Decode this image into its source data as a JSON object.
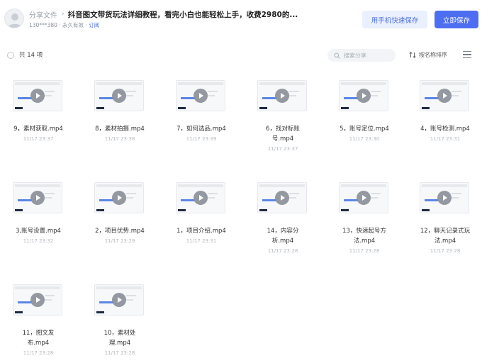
{
  "header": {
    "crumb_link": "分享文件",
    "crumb_sep": "›",
    "title": "抖音图文带货玩法详细教程，看完小白也能轻松上手，收费2980的...",
    "user_meta": "130***380 · 永久有效 · ",
    "subscribe": "订阅",
    "mobile_save": "用手机快速保存",
    "save_now": "立即保存"
  },
  "toolbar": {
    "count": "共 14 项",
    "search_placeholder": "搜索分享",
    "sort_label": "按名称排序"
  },
  "files": [
    {
      "line1": "9，素材获取.mp4",
      "line2": "",
      "date": "11/17 23:37"
    },
    {
      "line1": "8，素材拍摄.mp4",
      "line2": "",
      "date": "11/17 23:38"
    },
    {
      "line1": "7，如何选品.mp4",
      "line2": "",
      "date": "11/17 23:39"
    },
    {
      "line1": "6，找对标账",
      "line2": "号.mp4",
      "date": "11/17 23:37"
    },
    {
      "line1": "5，账号定位.mp4",
      "line2": "",
      "date": "11/17 23:30"
    },
    {
      "line1": "4，账号检测.mp4",
      "line2": "",
      "date": "11/17 23:31"
    },
    {
      "line1": "3,账号设置.mp4",
      "line2": "",
      "date": "11/17 23:32"
    },
    {
      "line1": "2，项目优势.mp4",
      "line2": "",
      "date": "11/17 23:29"
    },
    {
      "line1": "1，项目介绍.mp4",
      "line2": "",
      "date": "11/17 23:31"
    },
    {
      "line1": "14，内容分",
      "line2": "析.mp4",
      "date": "11/17 23:28"
    },
    {
      "line1": "13，快速起号方",
      "line2": "法.mp4",
      "date": "11/17 23:28"
    },
    {
      "line1": "12，聊天记录式玩",
      "line2": "法.mp4",
      "date": "11/17 23:28"
    },
    {
      "line1": "11，图文发",
      "line2": "布.mp4",
      "date": "11/17 23:28"
    },
    {
      "line1": "10，素材处",
      "line2": "理.mp4",
      "date": "11/17 23:28"
    }
  ],
  "icons": {
    "avatar": "avatar-icon",
    "search": "search-icon",
    "sort": "sort-icon",
    "menu": "menu-icon",
    "play": "play-icon"
  },
  "colors": {
    "accent": "#4e6ef2",
    "accent_light": "#eaf0fd",
    "muted_text": "#b3b8bf"
  }
}
